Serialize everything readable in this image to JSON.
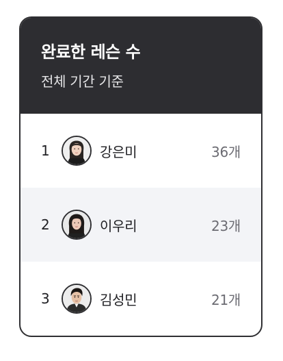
{
  "card": {
    "title": "완료한 레슨 수",
    "subtitle": "전체 기간 기준"
  },
  "ranking": [
    {
      "rank": "1",
      "name": "강은미",
      "count": "36개",
      "avatar_icon": "woman-portrait-icon"
    },
    {
      "rank": "2",
      "name": "이우리",
      "count": "23개",
      "avatar_icon": "woman-portrait-icon"
    },
    {
      "rank": "3",
      "name": "김성민",
      "count": "21개",
      "avatar_icon": "man-portrait-icon"
    }
  ],
  "colors": {
    "header_bg": "#2d2d31",
    "alt_row_bg": "#f3f4f7",
    "border": "#2f2f32",
    "count_text": "#6b6b72"
  }
}
